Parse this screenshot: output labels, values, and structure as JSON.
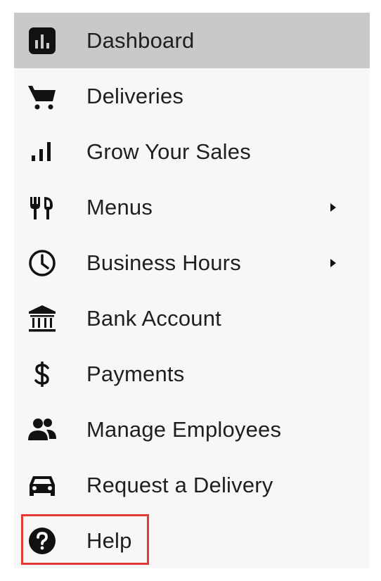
{
  "nav": {
    "items": [
      {
        "label": "Dashboard",
        "icon": "dashboard-icon",
        "active": true,
        "submenu": false
      },
      {
        "label": "Deliveries",
        "icon": "cart-icon",
        "active": false,
        "submenu": false
      },
      {
        "label": "Grow Your Sales",
        "icon": "bar-chart-icon",
        "active": false,
        "submenu": false
      },
      {
        "label": "Menus",
        "icon": "fork-knife-icon",
        "active": false,
        "submenu": true
      },
      {
        "label": "Business Hours",
        "icon": "clock-icon",
        "active": false,
        "submenu": true
      },
      {
        "label": "Bank Account",
        "icon": "bank-icon",
        "active": false,
        "submenu": false
      },
      {
        "label": "Payments",
        "icon": "dollar-icon",
        "active": false,
        "submenu": false
      },
      {
        "label": "Manage Employees",
        "icon": "people-icon",
        "active": false,
        "submenu": false
      },
      {
        "label": "Request a Delivery",
        "icon": "car-icon",
        "active": false,
        "submenu": false
      },
      {
        "label": "Help",
        "icon": "help-icon",
        "active": false,
        "submenu": false,
        "highlighted": true
      }
    ]
  },
  "colors": {
    "active_bg": "#c9c9c9",
    "menu_bg": "#f7f7f7",
    "text": "#1f1f1f",
    "highlight": "#e53935"
  }
}
